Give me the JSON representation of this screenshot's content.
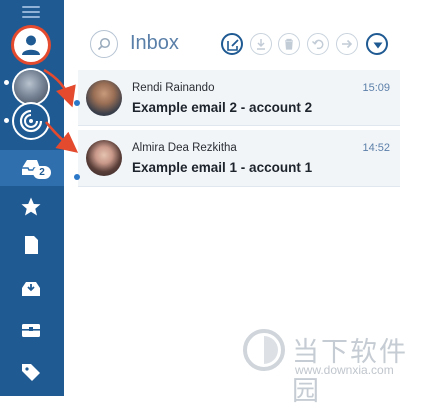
{
  "app": {
    "inbox_title": "Inbox"
  },
  "sidebar": {
    "compose_badge": "2",
    "icons": [
      "menu-icon",
      "user-icon",
      "account-photo",
      "account-swirl-icon",
      "drafts-icon",
      "star-icon",
      "document-icon",
      "inbox-tray-icon",
      "archive-icon",
      "tag-icon"
    ]
  },
  "toolbar": {
    "icons": [
      "search-icon",
      "compose-icon",
      "download-icon",
      "trash-icon",
      "undo-icon",
      "forward-icon",
      "menu-chevron-icon"
    ]
  },
  "emails": [
    {
      "sender": "Rendi Rainando",
      "subject": "Example email 2 - account 2",
      "time": "15:09"
    },
    {
      "sender": "Almira Dea Rezkitha",
      "subject": "Example email 1 - account 1",
      "time": "14:52"
    }
  ],
  "colors": {
    "sidebar": "#1f5a93",
    "highlight": "#e44a2e",
    "time": "#5b7fa9"
  },
  "watermark": {
    "chinese": "当下软件园",
    "url": "www.downxia.com"
  }
}
